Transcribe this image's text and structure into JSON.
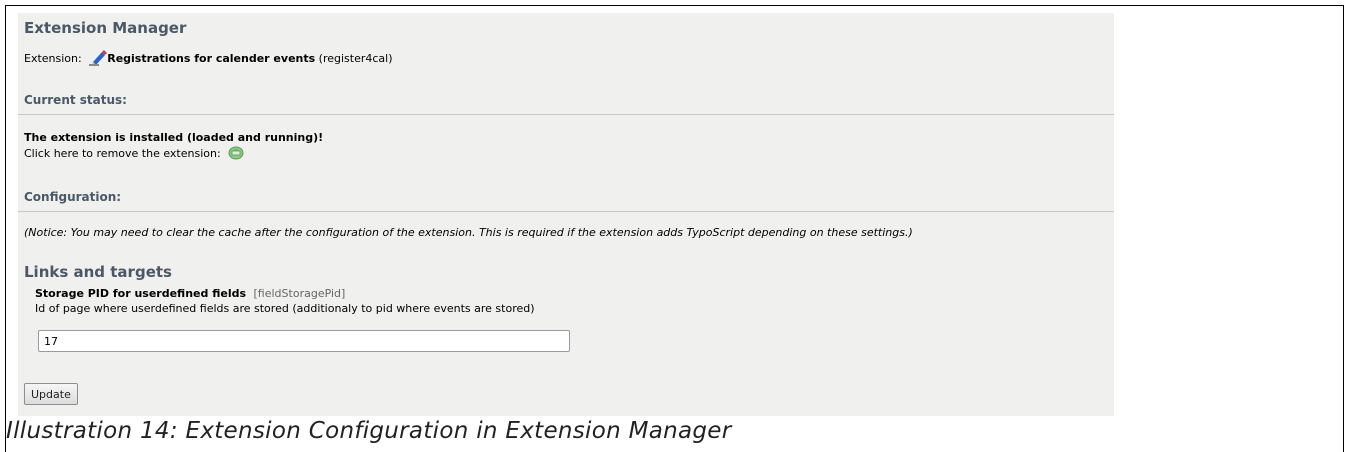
{
  "header": {
    "title": "Extension Manager"
  },
  "extension": {
    "prefix": "Extension:",
    "name": "Registrations for calender events",
    "key": "(register4cal)",
    "icon": "extension-pencil-icon"
  },
  "status": {
    "heading": "Current status:",
    "installed_text": "The extension is installed (loaded and running)!",
    "remove_text": "Click here to remove the extension:",
    "remove_icon": "remove-extension-icon"
  },
  "configuration": {
    "heading": "Configuration:",
    "notice": "(Notice: You may need to clear the cache after the configuration of the extension. This is required if the extension adds TypoScript depending on these settings.)"
  },
  "links_targets": {
    "heading": "Links and targets",
    "field": {
      "label": "Storage PID for userdefined fields",
      "key": "[fieldStoragePid]",
      "description": "Id of page where userdefined fields are stored (additionaly to pid where events are stored)",
      "value": "17"
    }
  },
  "actions": {
    "update_label": "Update"
  },
  "caption": "Illustration 14: Extension Configuration in Extension Manager",
  "colors": {
    "panel_bg": "#f0f0ee",
    "heading": "#4a5868"
  }
}
